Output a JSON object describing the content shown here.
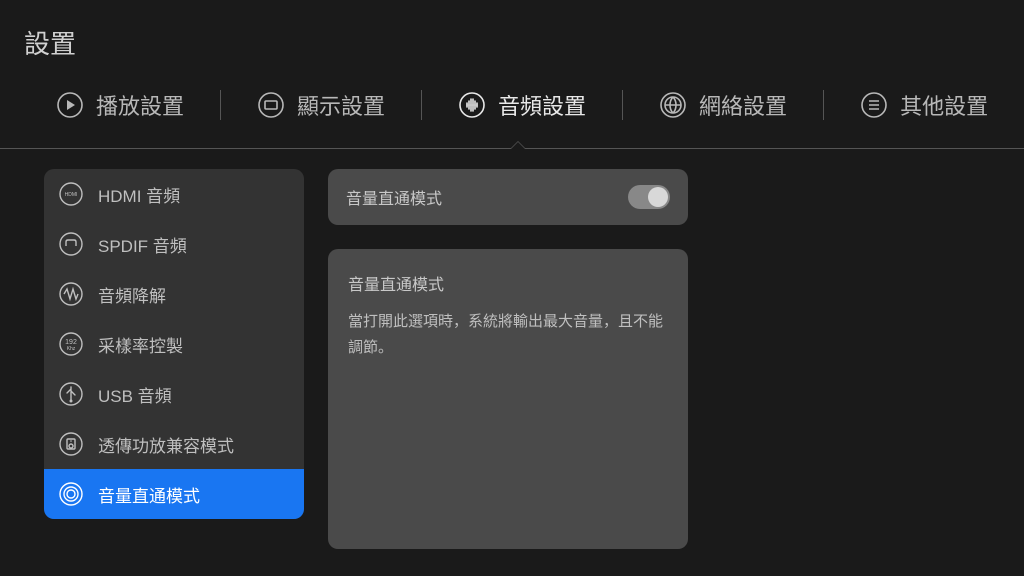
{
  "page_title": "設置",
  "tabs": [
    {
      "label": "播放設置",
      "icon": "play"
    },
    {
      "label": "顯示設置",
      "icon": "monitor"
    },
    {
      "label": "音頻設置",
      "icon": "equalizer",
      "active": true
    },
    {
      "label": "網絡設置",
      "icon": "globe"
    },
    {
      "label": "其他設置",
      "icon": "list"
    }
  ],
  "sidebar": {
    "items": [
      {
        "label": "HDMI 音頻",
        "icon": "hdmi"
      },
      {
        "label": "SPDIF 音頻",
        "icon": "spdif"
      },
      {
        "label": "音頻降解",
        "icon": "wave"
      },
      {
        "label": "采樣率控製",
        "icon": "khz"
      },
      {
        "label": "USB 音頻",
        "icon": "usb"
      },
      {
        "label": "透傳功放兼容模式",
        "icon": "speaker"
      },
      {
        "label": "音量直通模式",
        "icon": "volume",
        "selected": true
      }
    ]
  },
  "main": {
    "toggle_label": "音量直通模式",
    "toggle_state": "off",
    "desc_title": "音量直通模式",
    "desc_body": "當打開此選項時，系統將輸出最大音量，且不能調節。"
  }
}
